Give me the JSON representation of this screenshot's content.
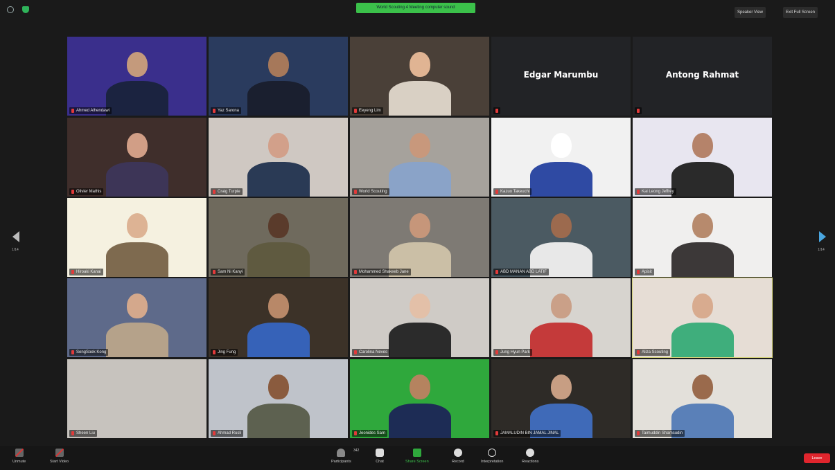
{
  "topbar": {
    "banner": "World Scouting 4 Meeting computer sound",
    "speaker_view": "Speaker View",
    "exit_fullscreen": "Exit Full Screen"
  },
  "pager": {
    "left": "1/14",
    "right": "1/14"
  },
  "participants": [
    {
      "name": "Ahmed Alhendawi",
      "bg": "#3a2f8c",
      "skin": "#c49a7c",
      "shirt": "#1b2340"
    },
    {
      "name": "Yaz Sarona",
      "bg": "#2a3b5e",
      "skin": "#a6785a",
      "shirt": "#1a1f2f"
    },
    {
      "name": "Eeyeng Lim",
      "bg": "#4a4038",
      "skin": "#e0b493",
      "shirt": "#d9d0c4"
    },
    {
      "name": "",
      "big": "Edgar Marumbu",
      "bg": "#222326"
    },
    {
      "name": "",
      "big": "Antong Rahmat",
      "bg": "#222326"
    },
    {
      "name": "Olivier Mathis",
      "bg": "#3f2e2b",
      "skin": "#d19e86",
      "shirt": "#3d3557"
    },
    {
      "name": "Craig Turpie",
      "bg": "#cfc8c2",
      "skin": "#d2a08a",
      "shirt": "#2a3a55"
    },
    {
      "name": "World Scouting",
      "bg": "#a6a29c",
      "skin": "#c8987c",
      "shirt": "#8aa3c8"
    },
    {
      "name": "Kazuo Takeuchi",
      "bg": "#f1f1f1",
      "skin": "#ffffff",
      "shirt": "#2f4aa3"
    },
    {
      "name": "Kai Leong Jeffrey",
      "bg": "#e8e6f0",
      "skin": "#b5836a",
      "shirt": "#2a2a2a"
    },
    {
      "name": "Hiroaki Kanai",
      "bg": "#f5f1e0",
      "skin": "#ddb394",
      "shirt": "#7e6a4f"
    },
    {
      "name": "Sam Ni Kanyi",
      "bg": "#6f6a5d",
      "skin": "#5a3b2b",
      "shirt": "#5f5a40"
    },
    {
      "name": "Mohammed Shakeeb Jane",
      "bg": "#7e7a74",
      "skin": "#c6967a",
      "shirt": "#cbbfa6"
    },
    {
      "name": "ABD MANAN ABD LATIF",
      "bg": "#4b5a62",
      "skin": "#9c6a4e",
      "shirt": "#e8e8e8"
    },
    {
      "name": "Apisit",
      "bg": "#f0efee",
      "skin": "#b78a6d",
      "shirt": "#3c3838"
    },
    {
      "name": "SengSoek Kong",
      "bg": "#5e6a8a",
      "skin": "#d4a88c",
      "shirt": "#b5a28a"
    },
    {
      "name": "Jing Fung",
      "bg": "#3c3228",
      "skin": "#b88868",
      "shirt": "#3662b8"
    },
    {
      "name": "Carolina Neves",
      "bg": "#cfcbc6",
      "skin": "#e3c0a8",
      "shirt": "#2b2b2b"
    },
    {
      "name": "Jung Hyun Park",
      "bg": "#d7d4cf",
      "skin": "#caa088",
      "shirt": "#c43a3a"
    },
    {
      "name": "Aliza Scouting",
      "bg": "#e6ddd5",
      "skin": "#d8ab8f",
      "shirt": "#3fae7c",
      "selected": true
    },
    {
      "name": "Sheen Liu",
      "bg": "#c7c3be",
      "skin": "#c7c3be",
      "shirt": "#c7c3be"
    },
    {
      "name": "Ahmad Rusli",
      "bg": "#bfc3ca",
      "skin": "#8a5b3e",
      "shirt": "#5d6150"
    },
    {
      "name": "Jeonides Sam",
      "bg": "#2fa83c",
      "skin": "#b5835f",
      "shirt": "#1d2c55"
    },
    {
      "name": "JAMALUDIN BIN JAMAL JINAL",
      "bg": "#2e2b27",
      "skin": "#c79e83",
      "shirt": "#3f6ab8"
    },
    {
      "name": "Taimuddin Shamsudin",
      "bg": "#e3e0da",
      "skin": "#9a6a4c",
      "shirt": "#5a80b8"
    }
  ],
  "toolbar": {
    "unmute": "Unmute",
    "start_video": "Start Video",
    "participants_count": "342",
    "participants": "Participants",
    "chat": "Chat",
    "share_screen": "Share Screen",
    "record": "Record",
    "interpretation": "Interpretation",
    "reactions": "Reactions",
    "leave": "Leave"
  }
}
